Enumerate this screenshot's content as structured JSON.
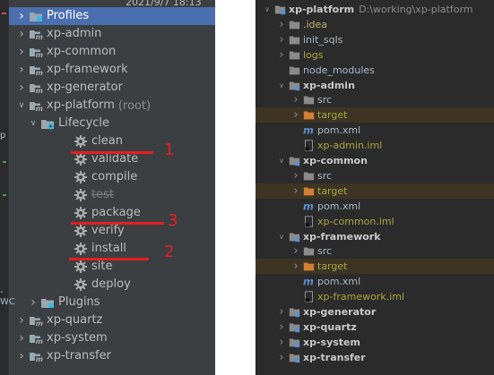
{
  "colors": {
    "left_bg": "#3c3f41",
    "right_bg": "#2b2b2b",
    "selection": "#4b6eaf",
    "annotation_red": "#e41e24",
    "folder_gray": "#8a8a8a",
    "folder_blue": "#5e8fd0",
    "folder_orange": "#d17f34",
    "gear": "#aaaaaa"
  },
  "left_panel": {
    "behind_text": "2021/9/7 18:13",
    "gutter_frag_p": "p",
    "gutter_frag_wc": "-WC",
    "tree": [
      {
        "label": "Profiles",
        "icon": "profiles-icon",
        "arrow": "right",
        "level": 0,
        "selected": true
      },
      {
        "label": "xp-admin",
        "icon": "maven-module-icon",
        "arrow": "right",
        "level": 0
      },
      {
        "label": "xp-common",
        "icon": "maven-module-icon",
        "arrow": "right",
        "level": 0
      },
      {
        "label": "xp-framework",
        "icon": "maven-module-icon",
        "arrow": "right",
        "level": 0
      },
      {
        "label": "xp-generator",
        "icon": "maven-module-icon",
        "arrow": "right",
        "level": 0
      },
      {
        "label": "xp-platform",
        "suffix": "(root)",
        "icon": "maven-module-icon",
        "arrow": "down",
        "level": 0
      },
      {
        "label": "Lifecycle",
        "icon": "lifecycle-folder-icon",
        "arrow": "down",
        "level": 1
      },
      {
        "label": "clean",
        "icon": "gear-icon",
        "level": 2
      },
      {
        "label": "validate",
        "icon": "gear-icon",
        "level": 2
      },
      {
        "label": "compile",
        "icon": "gear-icon",
        "level": 2
      },
      {
        "label": "test",
        "icon": "gear-icon",
        "level": 2,
        "strike": true
      },
      {
        "label": "package",
        "icon": "gear-icon",
        "level": 2
      },
      {
        "label": "verify",
        "icon": "gear-icon",
        "level": 2
      },
      {
        "label": "install",
        "icon": "gear-icon",
        "level": 2
      },
      {
        "label": "site",
        "icon": "gear-icon",
        "level": 2
      },
      {
        "label": "deploy",
        "icon": "gear-icon",
        "level": 2
      },
      {
        "label": "Plugins",
        "icon": "plugins-folder-icon",
        "arrow": "right",
        "level": 1
      },
      {
        "label": "xp-quartz",
        "icon": "maven-module-icon",
        "arrow": "right",
        "level": 0
      },
      {
        "label": "xp-system",
        "icon": "maven-module-icon",
        "arrow": "right",
        "level": 0
      },
      {
        "label": "xp-transfer",
        "icon": "maven-module-icon",
        "arrow": "right",
        "level": 0
      }
    ],
    "annotations": [
      {
        "label": "1"
      },
      {
        "label": "3"
      },
      {
        "label": "2"
      }
    ]
  },
  "right_panel": {
    "tree": [
      {
        "label": "xp-platform",
        "path": "D:\\working\\xp-platform",
        "icon": "module-folder-icon",
        "arrow": "down",
        "level": 0,
        "bold": true
      },
      {
        "label": ".idea",
        "icon": "folder-icon",
        "arrow": "right",
        "level": 1,
        "style": "yellowish"
      },
      {
        "label": "init_sqls",
        "icon": "folder-icon",
        "arrow": "right",
        "level": 1
      },
      {
        "label": "logs",
        "icon": "folder-icon",
        "arrow": "right",
        "level": 1,
        "style": "greenish"
      },
      {
        "label": "node_modules",
        "icon": "folder-icon",
        "level": 1
      },
      {
        "label": "xp-admin",
        "icon": "module-folder-icon",
        "arrow": "down",
        "level": 1,
        "bold": true
      },
      {
        "label": "src",
        "icon": "folder-icon",
        "arrow": "right",
        "level": 2
      },
      {
        "label": "target",
        "icon": "excluded-folder-icon",
        "arrow": "right",
        "level": 2,
        "style": "greenish",
        "excluded": true
      },
      {
        "label": "pom.xml",
        "icon": "maven-pom-icon",
        "level": 2
      },
      {
        "label": "xp-admin.iml",
        "icon": "iml-file-icon",
        "level": 2,
        "style": "greenish"
      },
      {
        "label": "xp-common",
        "icon": "module-folder-icon",
        "arrow": "down",
        "level": 1,
        "bold": true
      },
      {
        "label": "src",
        "icon": "folder-icon",
        "arrow": "right",
        "level": 2
      },
      {
        "label": "target",
        "icon": "excluded-folder-icon",
        "arrow": "right",
        "level": 2,
        "style": "greenish",
        "excluded": true
      },
      {
        "label": "pom.xml",
        "icon": "maven-pom-icon",
        "level": 2
      },
      {
        "label": "xp-common.iml",
        "icon": "iml-file-icon",
        "level": 2,
        "style": "greenish"
      },
      {
        "label": "xp-framework",
        "icon": "module-folder-icon",
        "arrow": "down",
        "level": 1,
        "bold": true
      },
      {
        "label": "src",
        "icon": "folder-icon",
        "arrow": "right",
        "level": 2
      },
      {
        "label": "target",
        "icon": "excluded-folder-icon",
        "arrow": "right",
        "level": 2,
        "style": "greenish",
        "excluded": true
      },
      {
        "label": "pom.xml",
        "icon": "maven-pom-icon",
        "level": 2
      },
      {
        "label": "xp-framework.iml",
        "icon": "iml-file-icon",
        "level": 2,
        "style": "greenish"
      },
      {
        "label": "xp-generator",
        "icon": "module-folder-icon",
        "arrow": "right",
        "level": 1,
        "bold": true
      },
      {
        "label": "xp-quartz",
        "icon": "module-folder-icon",
        "arrow": "right",
        "level": 1,
        "bold": true
      },
      {
        "label": "xp-system",
        "icon": "module-folder-icon",
        "arrow": "right",
        "level": 1,
        "bold": true
      },
      {
        "label": "xp-transfer",
        "icon": "module-folder-icon",
        "arrow": "right",
        "level": 1,
        "bold": true
      }
    ]
  }
}
